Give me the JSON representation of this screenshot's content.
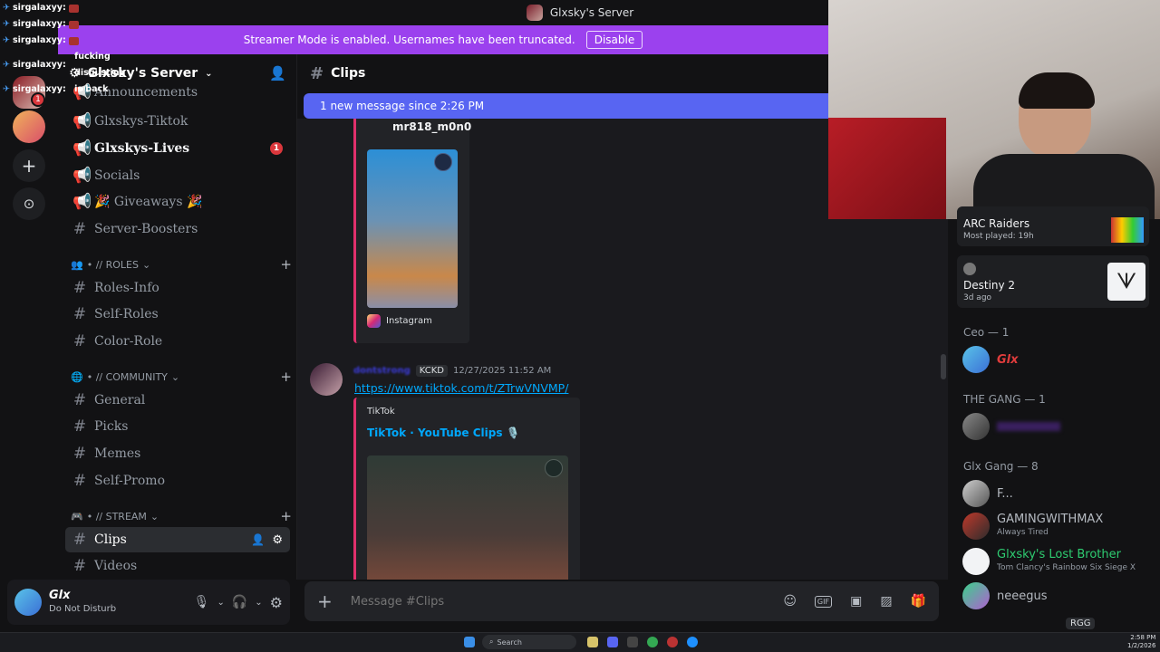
{
  "window": {
    "title": "Glxsky's Server"
  },
  "banner": {
    "text": "Streamer Mode is enabled. Usernames have been truncated.",
    "button": "Disable"
  },
  "overlay_chat": [
    {
      "user": "sirgalaxyy:",
      "msg": ""
    },
    {
      "user": "sirgalaxyy:",
      "msg": ""
    },
    {
      "user": "sirgalaxyy:",
      "msg": ""
    },
    {
      "user": "sirgalaxyy:",
      "msg": "fucking disgusting"
    },
    {
      "user": "sirgalaxyy:",
      "msg": "is back"
    }
  ],
  "rail": {
    "mention_badge": "1"
  },
  "server": {
    "name": "Glxsky's Server"
  },
  "channels": [
    {
      "name": "Announcements",
      "icon": "megaphone-icon"
    },
    {
      "name": "Glxskys-Tiktok",
      "icon": "megaphone-icon"
    },
    {
      "name": "Glxskys-Lives",
      "icon": "megaphone-icon",
      "badge": "1"
    },
    {
      "name": "Socials",
      "icon": "megaphone-icon"
    },
    {
      "name": "🎉 Giveaways 🎉",
      "icon": "megaphone-icon"
    },
    {
      "name": "Server-Boosters",
      "icon": "hash-icon"
    },
    {
      "name": "Roles-Info",
      "icon": "hash-icon"
    },
    {
      "name": "Self-Roles",
      "icon": "hash-icon"
    },
    {
      "name": "Color-Role",
      "icon": "hash-icon"
    },
    {
      "name": "General",
      "icon": "hash-icon"
    },
    {
      "name": "Picks",
      "icon": "hash-icon"
    },
    {
      "name": "Memes",
      "icon": "hash-icon"
    },
    {
      "name": "Self-Promo",
      "icon": "hash-icon"
    },
    {
      "name": "Clips",
      "icon": "hash-icon"
    },
    {
      "name": "Videos",
      "icon": "hash-icon"
    }
  ],
  "categories": [
    "• // ROLES",
    "• // COMMUNITY",
    "• // STREAM"
  ],
  "user": {
    "name": "Glx",
    "status": "Do Not Disturb"
  },
  "channel_header": {
    "name": "Clips"
  },
  "new_messages": "1 new message since 2:26 PM",
  "messages": {
    "embed1_user": "mr818_m0n0",
    "embed1_provider": "Instagram",
    "msg2_author": "dontstrong",
    "msg2_tag": "KCKD",
    "msg2_time": "12/27/2025 11:52 AM",
    "msg2_link": "https://www.tiktok.com/t/ZTrwVNVMP/",
    "embed2_provider": "TikTok",
    "embed2_title": "TikTok · YouTube Clips 🎙️"
  },
  "composer": {
    "placeholder": "Message #Clips"
  },
  "members": {
    "activity1": {
      "game": "ARC Raiders",
      "sub": "Most played: 19h"
    },
    "activity2": {
      "game": "Destiny 2",
      "sub": "3d ago"
    },
    "groups": [
      "Ceo — 1",
      "THE GANG — 1",
      "Glx Gang — 8"
    ],
    "list": [
      {
        "name": "Glx",
        "sub": "",
        "color": "#e03c3c"
      },
      {
        "name": "",
        "sub": "",
        "color": "#6e2bb8"
      },
      {
        "name": "F...",
        "sub": "",
        "color": "#b5bac1"
      },
      {
        "name": "GAMINGWITHMAX",
        "sub": "Always Tired",
        "color": "#b5bac1"
      },
      {
        "name": "Glxsky's Lost Brother",
        "sub": "Tom Clancy's Rainbow Six Siege X",
        "color": "#2ecc71"
      },
      {
        "name": "neeegus",
        "sub": "",
        "color": "#b5bac1"
      }
    ],
    "rgg_badge": "RGG"
  },
  "taskbar": {
    "search": "Search",
    "time": "2:58 PM",
    "date": "1/2/2026"
  }
}
